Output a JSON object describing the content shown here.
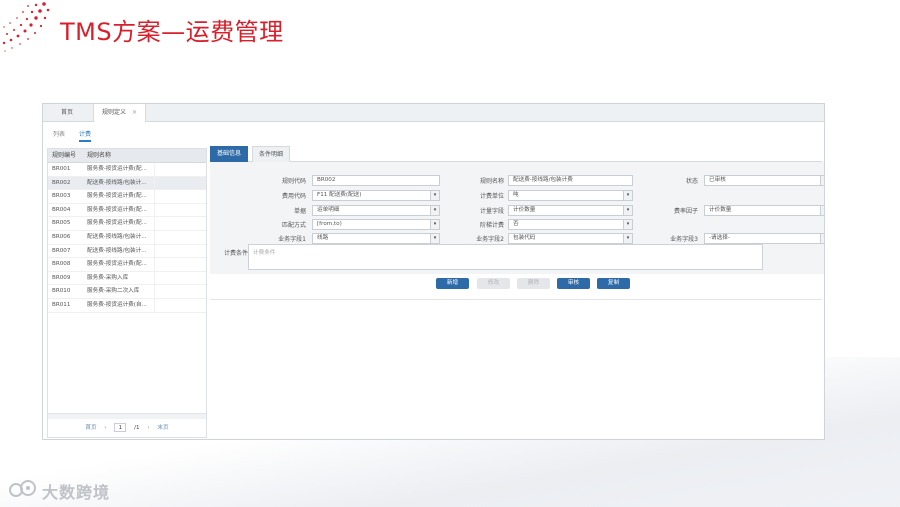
{
  "slide": {
    "title": "TMS方案—运费管理",
    "logo_text": "大数跨境",
    "accent_color": "#d8202c"
  },
  "window_tabs": [
    {
      "label": "首页",
      "active": false
    },
    {
      "label": "规则定义",
      "active": true,
      "close": "×"
    }
  ],
  "sub_tabs": [
    {
      "label": "列表",
      "active": false
    },
    {
      "label": "计费",
      "active": true
    }
  ],
  "grid": {
    "columns": [
      "规则编号",
      "规则名称"
    ],
    "rows": [
      {
        "code": "BR001",
        "name": "服务费-按货运计费(配..."
      },
      {
        "code": "BR002",
        "name": "配送费-按线路/包装计...",
        "selected": true
      },
      {
        "code": "BR003",
        "name": "服务费-按货运计费(配..."
      },
      {
        "code": "BR004",
        "name": "服务费-按货运计费(配..."
      },
      {
        "code": "BR005",
        "name": "服务费-按货运计费(配..."
      },
      {
        "code": "BR006",
        "name": "配送费-按线路/包装计..."
      },
      {
        "code": "BR007",
        "name": "配送费-按线路/包装计..."
      },
      {
        "code": "BR008",
        "name": "服务费-按货运计费(配..."
      },
      {
        "code": "BR009",
        "name": "服务费-采购入库"
      },
      {
        "code": "BR010",
        "name": "服务费-采购二次入库"
      },
      {
        "code": "BR011",
        "name": "服务费-按货运计费(自..."
      }
    ],
    "pager": {
      "first": "首页",
      "prev": "‹",
      "page": "1",
      "total": "/1",
      "next": "›",
      "last": "末页"
    }
  },
  "panel_tabs": [
    {
      "label": "基础信息",
      "active": true
    },
    {
      "label": "条件明细",
      "active": false
    }
  ],
  "form": {
    "rule_code": {
      "label": "规则代码",
      "value": "BR002"
    },
    "rule_name": {
      "label": "规则名称",
      "value": "配送费-按线路/包装计费"
    },
    "status": {
      "label": "状态",
      "value": "已审核"
    },
    "fee_code": {
      "label": "费用代码",
      "value": "F11 配送费(配送)"
    },
    "bill_unit": {
      "label": "计费单位",
      "value": "吨"
    },
    "doc": {
      "label": "单据",
      "value": "运单明细"
    },
    "bill_field": {
      "label": "计量字段",
      "value": "计价数量"
    },
    "rate_factor": {
      "label": "费率因子",
      "value": "计价数量"
    },
    "match_mode": {
      "label": "匹配方式",
      "value": "[from,to)"
    },
    "step_bill": {
      "label": "阶梯计费",
      "value": "否"
    },
    "biz_field1": {
      "label": "业务字段1",
      "value": "线路"
    },
    "biz_field2": {
      "label": "业务字段2",
      "value": "包装代码"
    },
    "biz_field3": {
      "label": "业务字段3",
      "value": "-请选择-"
    },
    "condition": {
      "label": "计费条件",
      "placeholder": "计费条件"
    }
  },
  "buttons": [
    {
      "label": "新增",
      "enabled": true
    },
    {
      "label": "修改",
      "enabled": false
    },
    {
      "label": "删除",
      "enabled": false
    },
    {
      "label": "审核",
      "enabled": true
    },
    {
      "label": "复制",
      "enabled": true
    }
  ],
  "icons": {
    "dropdown": "chevron-down-icon"
  }
}
